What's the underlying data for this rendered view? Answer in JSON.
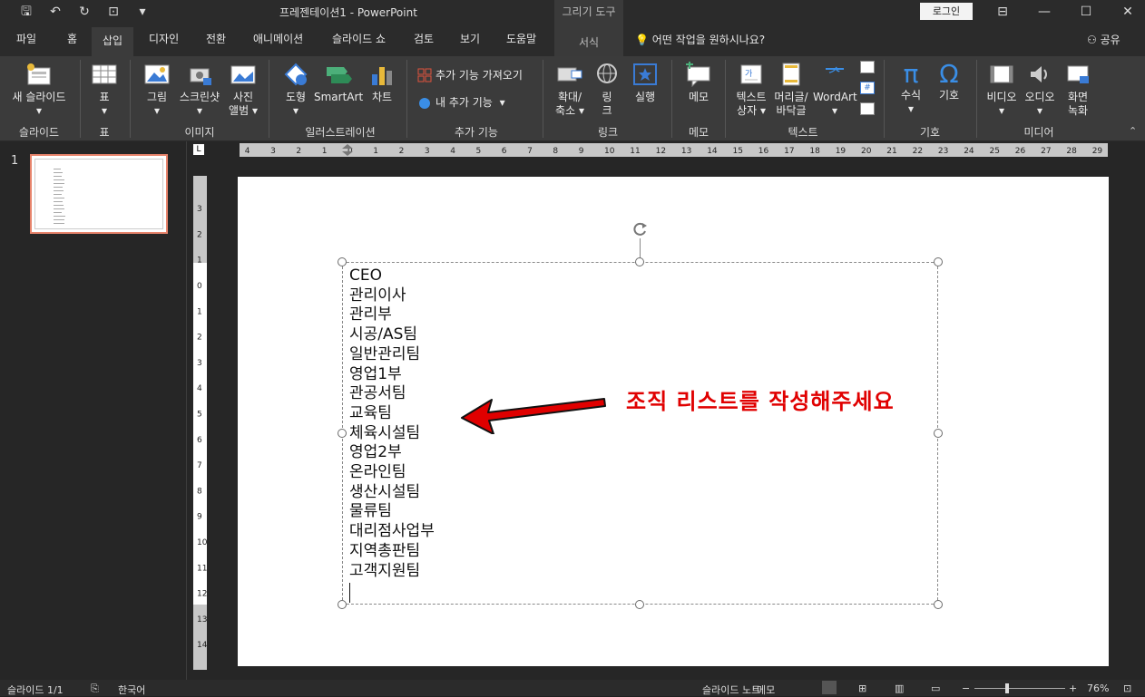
{
  "window": {
    "title": "프레젠테이션1  -  PowerPoint",
    "context_tab_header": "그리기 도구",
    "login_label": "로그인"
  },
  "ribbon_tabs": {
    "file": "파일",
    "home": "홈",
    "insert": "삽입",
    "design": "디자인",
    "transitions": "전환",
    "animations": "애니메이션",
    "slideshow": "슬라이드 쇼",
    "review": "검토",
    "view": "보기",
    "help": "도움말",
    "format": "서식",
    "tell_me": "어떤 작업을 원하시나요?",
    "share": "공유"
  },
  "ribbon": {
    "new_slide": "새 슬라이드",
    "table": "표",
    "picture": "그림",
    "screenshot": "스크린샷",
    "photo_album_1": "사진",
    "photo_album_2": "앨범",
    "shapes": "도형",
    "smartart": "SmartArt",
    "chart": "차트",
    "get_addins": "추가 기능 가져오기",
    "my_addins": "내 추가 기능",
    "zoom_1": "확대/",
    "zoom_2": "축소",
    "link_1": "링",
    "link_2": "크",
    "action": "실행",
    "comment": "메모",
    "textbox_1": "텍스트",
    "textbox_2": "상자",
    "header_1": "머리글/",
    "header_2": "바닥글",
    "wordart": "WordArt",
    "equation": "수식",
    "symbol": "기호",
    "video": "비디오",
    "audio": "오디오",
    "screen_rec_1": "화면",
    "screen_rec_2": "녹화",
    "groups": {
      "slides": "슬라이드",
      "tables": "표",
      "images": "이미지",
      "illustrations": "일러스트레이션",
      "addins": "추가 기능",
      "links": "링크",
      "comments": "메모",
      "text": "텍스트",
      "symbols": "기호",
      "media": "미디어"
    }
  },
  "thumbnail": {
    "number": "1"
  },
  "slide": {
    "org_list": [
      "CEO",
      "관리이사",
      "관리부",
      "시공/AS팀",
      "일반관리팀",
      "영업1부",
      "관공서팀",
      "교육팀",
      "체육시설팀",
      "영업2부",
      "온라인팀",
      "생산시설팀",
      "물류팀",
      "대리점사업부",
      "지역총판팀",
      "고객지원팀"
    ],
    "annotation": "조직 리스트를 작성해주세요"
  },
  "status": {
    "slide_count": "슬라이드 1/1",
    "language": "한국어",
    "notes": "슬라이드 노트",
    "comments": "메모",
    "zoom": "76%"
  },
  "colors": {
    "accent": "#e7846c",
    "annotation": "#e00000",
    "ribbon_bg": "#3b3b3b"
  }
}
